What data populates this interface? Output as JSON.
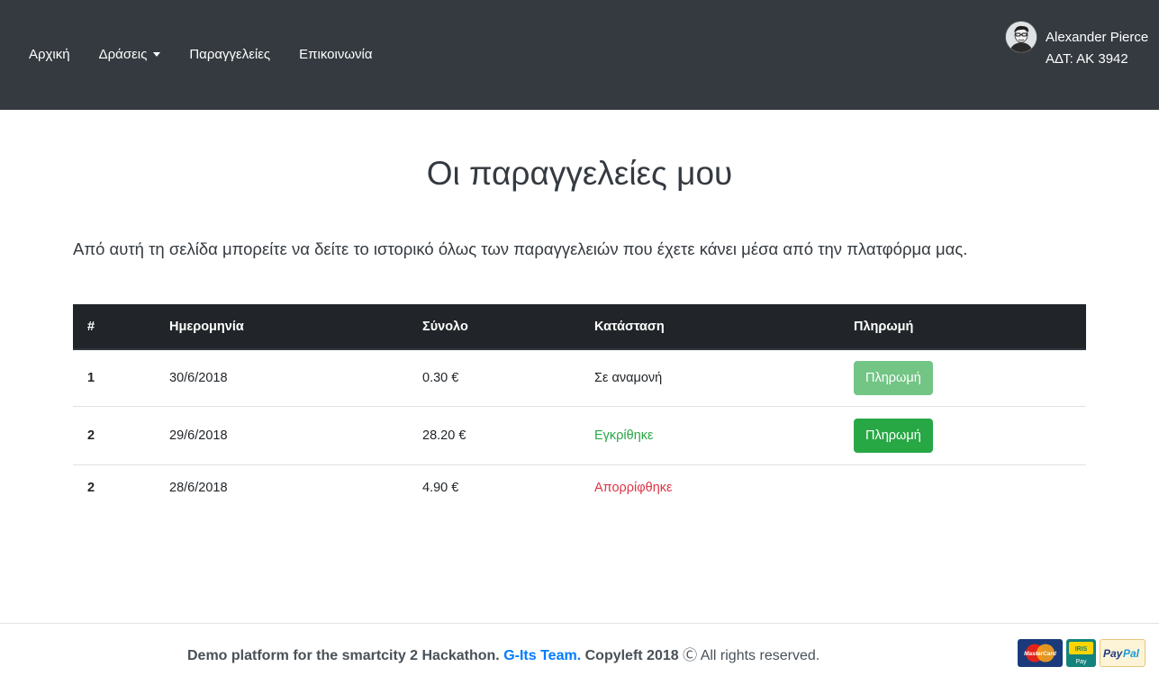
{
  "nav": {
    "items": [
      {
        "label": "Αρχική",
        "dropdown": false
      },
      {
        "label": "Δράσεις",
        "dropdown": true
      },
      {
        "label": "Παραγγελείες",
        "dropdown": false
      },
      {
        "label": "Επικοινωνία",
        "dropdown": false
      }
    ]
  },
  "user": {
    "name": "Alexander Pierce",
    "id_line": "ΑΔΤ: ΑΚ 3942"
  },
  "page": {
    "title": "Οι παραγγελείες μου",
    "lead": "Από αυτή τη σελίδα μπορείτε να δείτε το ιστορικό όλως των παραγγελειών που έχετε κάνει μέσα από την πλατφόρμα μας."
  },
  "table": {
    "headers": [
      "#",
      "Ημερομηνία",
      "Σύνολο",
      "Κατάσταση",
      "Πληρωμή"
    ],
    "rows": [
      {
        "id": "1",
        "date": "30/6/2018",
        "total": "0.30 €",
        "status": "Σε αναμονή",
        "status_color": "#212529",
        "pay_label": "Πληρωμή",
        "pay_state": "disabled"
      },
      {
        "id": "2",
        "date": "29/6/2018",
        "total": "28.20 €",
        "status": "Εγκρίθηκε",
        "status_color": "#28a745",
        "pay_label": "Πληρωμή",
        "pay_state": "enabled"
      },
      {
        "id": "2",
        "date": "28/6/2018",
        "total": "4.90 €",
        "status": "Απορρίφθηκε",
        "status_color": "#dc3545",
        "pay_label": "",
        "pay_state": "none"
      }
    ]
  },
  "footer": {
    "prefix": "Demo platform for the smartcity 2 Hackathon.",
    "team": "G-Its Team.",
    "copyleft": "Copyleft 2018",
    "copyleft_symbol": "Ⓒ",
    "rights": "All rights reserved.",
    "payment_icons": [
      "mastercard-icon",
      "iris-pay-icon",
      "paypal-icon"
    ],
    "payment_labels": {
      "iris_top": "IRIS",
      "iris_bottom": "Pay",
      "mastercard": "MasterCard",
      "paypal_pay": "Pay",
      "paypal_pal": "Pal"
    }
  },
  "colors": {
    "navbar": "#343a40",
    "table_header": "#212529",
    "success": "#28a745",
    "danger": "#dc3545",
    "link": "#007bff"
  }
}
